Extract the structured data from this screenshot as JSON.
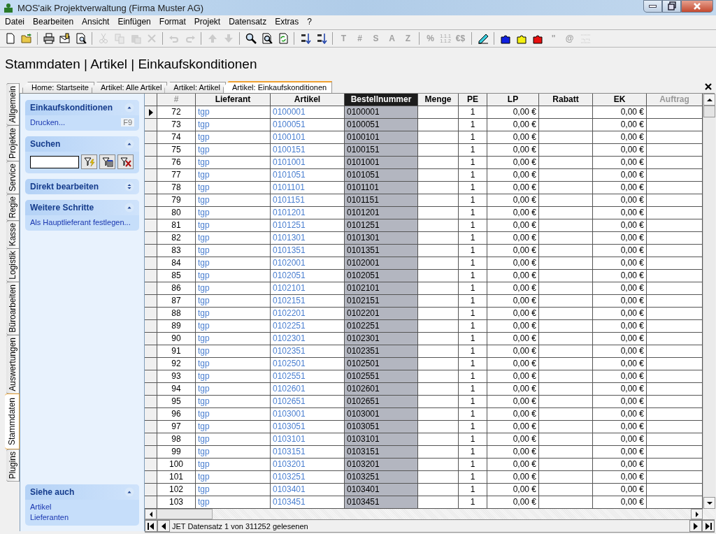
{
  "window": {
    "title": "MOS'aik Projektverwaltung (Firma Muster AG)"
  },
  "menu": [
    "Datei",
    "Bearbeiten",
    "Ansicht",
    "Einfügen",
    "Format",
    "Projekt",
    "Datensatz",
    "Extras",
    "?"
  ],
  "toolbar": [
    {
      "kind": "icon",
      "disabled": false
    },
    {
      "kind": "icon",
      "disabled": false
    },
    {
      "kind": "separator"
    },
    {
      "kind": "icon",
      "disabled": false
    },
    {
      "kind": "icon",
      "disabled": false
    },
    {
      "kind": "icon",
      "disabled": false
    },
    {
      "kind": "separator"
    },
    {
      "kind": "icon",
      "disabled": true
    },
    {
      "kind": "icon",
      "disabled": true
    },
    {
      "kind": "icon",
      "disabled": true
    },
    {
      "kind": "icon",
      "disabled": true
    },
    {
      "kind": "separator"
    },
    {
      "kind": "icon",
      "disabled": true
    },
    {
      "kind": "icon",
      "disabled": true
    },
    {
      "kind": "separator"
    },
    {
      "kind": "icon",
      "disabled": true
    },
    {
      "kind": "icon",
      "disabled": true
    },
    {
      "kind": "separator"
    },
    {
      "kind": "icon",
      "disabled": false
    },
    {
      "kind": "icon",
      "disabled": false
    },
    {
      "kind": "icon",
      "disabled": false
    },
    {
      "kind": "separator"
    },
    {
      "kind": "icon",
      "disabled": false
    },
    {
      "kind": "icon",
      "disabled": false
    },
    {
      "kind": "separator"
    },
    {
      "kind": "glyph",
      "text": "T",
      "disabled": true
    },
    {
      "kind": "glyph",
      "text": "#",
      "disabled": true
    },
    {
      "kind": "glyph",
      "text": "S",
      "disabled": true
    },
    {
      "kind": "glyph",
      "text": "A",
      "disabled": true
    },
    {
      "kind": "glyph",
      "text": "Z",
      "disabled": true
    },
    {
      "kind": "separator"
    },
    {
      "kind": "glyph",
      "text": "%",
      "disabled": true
    },
    {
      "kind": "glyph",
      "text": "1.1.1 1.1.2",
      "disabled": true
    },
    {
      "kind": "glyph",
      "text": "€$",
      "disabled": true
    },
    {
      "kind": "separator"
    },
    {
      "kind": "icon",
      "disabled": false
    },
    {
      "kind": "separator"
    },
    {
      "kind": "icon",
      "disabled": false
    },
    {
      "kind": "icon",
      "disabled": false
    },
    {
      "kind": "icon",
      "disabled": false
    },
    {
      "kind": "glyph",
      "text": "\"",
      "disabled": true
    },
    {
      "kind": "glyph",
      "text": "@",
      "disabled": true
    },
    {
      "kind": "icon",
      "disabled": true
    }
  ],
  "heading": "Stammdaten | Artikel | Einkaufskonditionen",
  "side_tabs": [
    {
      "label": "Allgemein",
      "selected": false
    },
    {
      "label": "Projekte",
      "selected": false
    },
    {
      "label": "Service",
      "selected": false
    },
    {
      "label": "Regie",
      "selected": false
    },
    {
      "label": "Kasse",
      "selected": false
    },
    {
      "label": "Logistik",
      "selected": false
    },
    {
      "label": "Büroarbeiten",
      "selected": false
    },
    {
      "label": "Auswertungen",
      "selected": false
    },
    {
      "label": "Stammdaten",
      "selected": true
    },
    {
      "label": "Plugins",
      "selected": false
    }
  ],
  "doc_tabs": [
    {
      "label": "Home: Startseite",
      "selected": false
    },
    {
      "label": "Artikel: Alle Artikel",
      "selected": false
    },
    {
      "label": "Artikel: Artikel",
      "selected": false
    },
    {
      "label": "Artikel: Einkaufskonditionen",
      "selected": true
    }
  ],
  "task_pane": {
    "sections": [
      {
        "kind": "links",
        "title": "Einkaufskonditionen",
        "expanded": true,
        "items": [
          {
            "label": "Drucken...",
            "shortcut": "F9"
          }
        ]
      },
      {
        "kind": "search",
        "title": "Suchen",
        "expanded": true
      },
      {
        "kind": "links",
        "title": "Direkt bearbeiten",
        "expanded": false
      },
      {
        "kind": "links",
        "title": "Weitere Schritte",
        "expanded": true,
        "items": [
          {
            "label": "Als Hauptlieferant festlegen..."
          }
        ]
      }
    ],
    "see_also": {
      "title": "Siehe auch",
      "expanded": true,
      "items": [
        {
          "label": "Artikel"
        },
        {
          "label": "Lieferanten"
        }
      ]
    }
  },
  "table": {
    "columns": [
      {
        "label": "#",
        "selected": false,
        "disabled": true
      },
      {
        "label": "Lieferant",
        "selected": false,
        "disabled": false
      },
      {
        "label": "Artikel",
        "selected": false,
        "disabled": false
      },
      {
        "label": "Bestellnummer",
        "selected": true,
        "disabled": false
      },
      {
        "label": "Menge",
        "selected": false,
        "disabled": false
      },
      {
        "label": "PE",
        "selected": false,
        "disabled": false
      },
      {
        "label": "LP",
        "selected": false,
        "disabled": false
      },
      {
        "label": "Rabatt",
        "selected": false,
        "disabled": false
      },
      {
        "label": "EK",
        "selected": false,
        "disabled": false
      },
      {
        "label": "Auftrag",
        "selected": false,
        "disabled": true
      }
    ],
    "rows": [
      {
        "selected": true,
        "cells": [
          "72",
          "tgp",
          "0100001",
          "0100001",
          "",
          "1",
          "0,00 €",
          "",
          "0,00 €",
          ""
        ]
      },
      {
        "selected": false,
        "cells": [
          "73",
          "tgp",
          "0100051",
          "0100051",
          "",
          "1",
          "0,00 €",
          "",
          "0,00 €",
          ""
        ]
      },
      {
        "selected": false,
        "cells": [
          "74",
          "tgp",
          "0100101",
          "0100101",
          "",
          "1",
          "0,00 €",
          "",
          "0,00 €",
          ""
        ]
      },
      {
        "selected": false,
        "cells": [
          "75",
          "tgp",
          "0100151",
          "0100151",
          "",
          "1",
          "0,00 €",
          "",
          "0,00 €",
          ""
        ]
      },
      {
        "selected": false,
        "cells": [
          "76",
          "tgp",
          "0101001",
          "0101001",
          "",
          "1",
          "0,00 €",
          "",
          "0,00 €",
          ""
        ]
      },
      {
        "selected": false,
        "cells": [
          "77",
          "tgp",
          "0101051",
          "0101051",
          "",
          "1",
          "0,00 €",
          "",
          "0,00 €",
          ""
        ]
      },
      {
        "selected": false,
        "cells": [
          "78",
          "tgp",
          "0101101",
          "0101101",
          "",
          "1",
          "0,00 €",
          "",
          "0,00 €",
          ""
        ]
      },
      {
        "selected": false,
        "cells": [
          "79",
          "tgp",
          "0101151",
          "0101151",
          "",
          "1",
          "0,00 €",
          "",
          "0,00 €",
          ""
        ]
      },
      {
        "selected": false,
        "cells": [
          "80",
          "tgp",
          "0101201",
          "0101201",
          "",
          "1",
          "0,00 €",
          "",
          "0,00 €",
          ""
        ]
      },
      {
        "selected": false,
        "cells": [
          "81",
          "tgp",
          "0101251",
          "0101251",
          "",
          "1",
          "0,00 €",
          "",
          "0,00 €",
          ""
        ]
      },
      {
        "selected": false,
        "cells": [
          "82",
          "tgp",
          "0101301",
          "0101301",
          "",
          "1",
          "0,00 €",
          "",
          "0,00 €",
          ""
        ]
      },
      {
        "selected": false,
        "cells": [
          "83",
          "tgp",
          "0101351",
          "0101351",
          "",
          "1",
          "0,00 €",
          "",
          "0,00 €",
          ""
        ]
      },
      {
        "selected": false,
        "cells": [
          "84",
          "tgp",
          "0102001",
          "0102001",
          "",
          "1",
          "0,00 €",
          "",
          "0,00 €",
          ""
        ]
      },
      {
        "selected": false,
        "cells": [
          "85",
          "tgp",
          "0102051",
          "0102051",
          "",
          "1",
          "0,00 €",
          "",
          "0,00 €",
          ""
        ]
      },
      {
        "selected": false,
        "cells": [
          "86",
          "tgp",
          "0102101",
          "0102101",
          "",
          "1",
          "0,00 €",
          "",
          "0,00 €",
          ""
        ]
      },
      {
        "selected": false,
        "cells": [
          "87",
          "tgp",
          "0102151",
          "0102151",
          "",
          "1",
          "0,00 €",
          "",
          "0,00 €",
          ""
        ]
      },
      {
        "selected": false,
        "cells": [
          "88",
          "tgp",
          "0102201",
          "0102201",
          "",
          "1",
          "0,00 €",
          "",
          "0,00 €",
          ""
        ]
      },
      {
        "selected": false,
        "cells": [
          "89",
          "tgp",
          "0102251",
          "0102251",
          "",
          "1",
          "0,00 €",
          "",
          "0,00 €",
          ""
        ]
      },
      {
        "selected": false,
        "cells": [
          "90",
          "tgp",
          "0102301",
          "0102301",
          "",
          "1",
          "0,00 €",
          "",
          "0,00 €",
          ""
        ]
      },
      {
        "selected": false,
        "cells": [
          "91",
          "tgp",
          "0102351",
          "0102351",
          "",
          "1",
          "0,00 €",
          "",
          "0,00 €",
          ""
        ]
      },
      {
        "selected": false,
        "cells": [
          "92",
          "tgp",
          "0102501",
          "0102501",
          "",
          "1",
          "0,00 €",
          "",
          "0,00 €",
          ""
        ]
      },
      {
        "selected": false,
        "cells": [
          "93",
          "tgp",
          "0102551",
          "0102551",
          "",
          "1",
          "0,00 €",
          "",
          "0,00 €",
          ""
        ]
      },
      {
        "selected": false,
        "cells": [
          "94",
          "tgp",
          "0102601",
          "0102601",
          "",
          "1",
          "0,00 €",
          "",
          "0,00 €",
          ""
        ]
      },
      {
        "selected": false,
        "cells": [
          "95",
          "tgp",
          "0102651",
          "0102651",
          "",
          "1",
          "0,00 €",
          "",
          "0,00 €",
          ""
        ]
      },
      {
        "selected": false,
        "cells": [
          "96",
          "tgp",
          "0103001",
          "0103001",
          "",
          "1",
          "0,00 €",
          "",
          "0,00 €",
          ""
        ]
      },
      {
        "selected": false,
        "cells": [
          "97",
          "tgp",
          "0103051",
          "0103051",
          "",
          "1",
          "0,00 €",
          "",
          "0,00 €",
          ""
        ]
      },
      {
        "selected": false,
        "cells": [
          "98",
          "tgp",
          "0103101",
          "0103101",
          "",
          "1",
          "0,00 €",
          "",
          "0,00 €",
          ""
        ]
      },
      {
        "selected": false,
        "cells": [
          "99",
          "tgp",
          "0103151",
          "0103151",
          "",
          "1",
          "0,00 €",
          "",
          "0,00 €",
          ""
        ]
      },
      {
        "selected": false,
        "cells": [
          "100",
          "tgp",
          "0103201",
          "0103201",
          "",
          "1",
          "0,00 €",
          "",
          "0,00 €",
          ""
        ]
      },
      {
        "selected": false,
        "cells": [
          "101",
          "tgp",
          "0103251",
          "0103251",
          "",
          "1",
          "0,00 €",
          "",
          "0,00 €",
          ""
        ]
      },
      {
        "selected": false,
        "cells": [
          "102",
          "tgp",
          "0103401",
          "0103401",
          "",
          "1",
          "0,00 €",
          "",
          "0,00 €",
          ""
        ]
      },
      {
        "selected": false,
        "cells": [
          "103",
          "tgp",
          "0103451",
          "0103451",
          "",
          "1",
          "0,00 €",
          "",
          "0,00 €",
          ""
        ]
      }
    ]
  },
  "status_bar": {
    "text": "JET Datensatz 1 von 311252 gelesenen"
  }
}
